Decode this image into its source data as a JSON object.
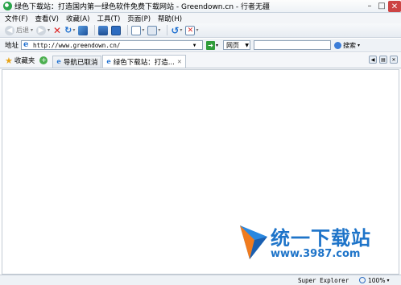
{
  "window": {
    "title": "绿色下载站：打造国内第一绿色软件免费下载网站 - Greendown.cn - 行者无疆"
  },
  "menu": [
    "文件(F)",
    "查看(V)",
    "收藏(A)",
    "工具(T)",
    "页面(P)",
    "帮助(H)"
  ],
  "toolbar": {
    "back_label": "后退"
  },
  "address": {
    "label": "地址",
    "url": "http://www.greendown.cn/",
    "mode": "网页",
    "search_label": "搜索"
  },
  "tabs": {
    "favorites_label": "收藏夹",
    "items": [
      {
        "label": "导航已取消"
      },
      {
        "label": "绿色下载站：打造..."
      }
    ]
  },
  "watermark": {
    "name": "统一下载站",
    "url": "www.3987.com"
  },
  "status": {
    "app": "Super Explorer",
    "zoom": "100%"
  },
  "colors": {
    "accent": "#1e74c9",
    "close": "#c44444",
    "go": "#2f9c3a"
  }
}
